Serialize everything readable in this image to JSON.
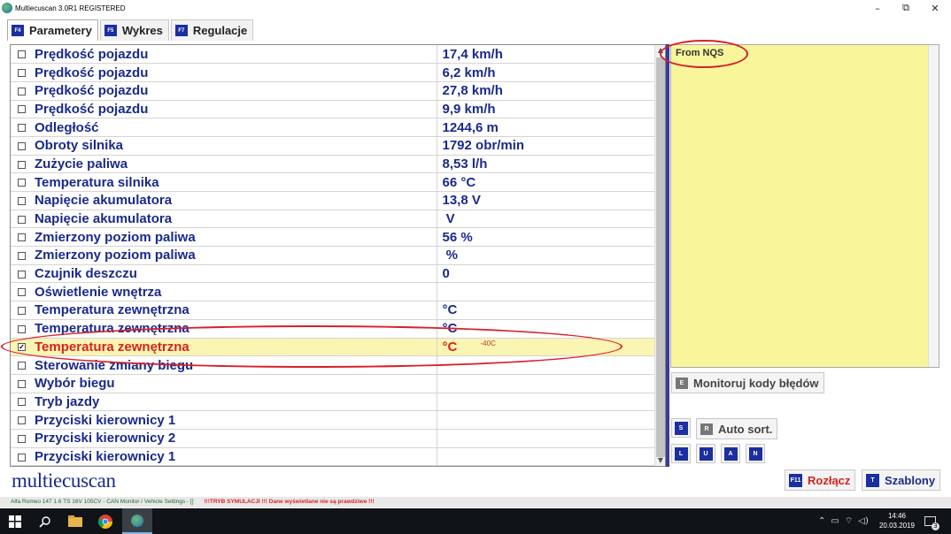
{
  "window": {
    "title": "Multiecuscan 3.0R1 REGISTERED"
  },
  "window_controls": {
    "minimize": "–",
    "maximize": "⧉",
    "close": "✕"
  },
  "tabs": [
    {
      "key": "F4",
      "label": "Parametery"
    },
    {
      "key": "F5",
      "label": "Wykres"
    },
    {
      "key": "F7",
      "label": "Regulacje"
    }
  ],
  "parameters": [
    {
      "checked": false,
      "name": "Prędkość pojazdu",
      "value": "17,4 km/h"
    },
    {
      "checked": false,
      "name": "Prędkość pojazdu",
      "value": "6,2 km/h"
    },
    {
      "checked": false,
      "name": "Prędkość pojazdu",
      "value": "27,8 km/h"
    },
    {
      "checked": false,
      "name": "Prędkość pojazdu",
      "value": "9,9 km/h"
    },
    {
      "checked": false,
      "name": "Odległość",
      "value": "1244,6 m"
    },
    {
      "checked": false,
      "name": "Obroty silnika",
      "value": "1792 obr/min"
    },
    {
      "checked": false,
      "name": "Zużycie paliwa",
      "value": "8,53 l/h"
    },
    {
      "checked": false,
      "name": "Temperatura silnika",
      "value": "66 °C"
    },
    {
      "checked": false,
      "name": "Napięcie akumulatora",
      "value": "13,8 V"
    },
    {
      "checked": false,
      "name": "Napięcie akumulatora",
      "value": " V"
    },
    {
      "checked": false,
      "name": "Zmierzony poziom paliwa",
      "value": "56 %"
    },
    {
      "checked": false,
      "name": "Zmierzony poziom paliwa",
      "value": " %"
    },
    {
      "checked": false,
      "name": "Czujnik deszczu",
      "value": "0"
    },
    {
      "checked": false,
      "name": "Oświetlenie wnętrza",
      "value": ""
    },
    {
      "checked": false,
      "name": "Temperatura zewnętrzna",
      "value": "°C"
    },
    {
      "checked": false,
      "name": "Temperatura zewnętrzna",
      "value": "°C"
    },
    {
      "checked": true,
      "name": "Temperatura zewnętrzna",
      "value": "°C",
      "note": "-40C",
      "highlighted": true
    },
    {
      "checked": false,
      "name": "Sterowanie zmiany biegu",
      "value": ""
    },
    {
      "checked": false,
      "name": "Wybór biegu",
      "value": ""
    },
    {
      "checked": false,
      "name": "Tryb jazdy",
      "value": ""
    },
    {
      "checked": false,
      "name": "Przyciski kierownicy 1",
      "value": ""
    },
    {
      "checked": false,
      "name": "Przyciski kierownicy 2",
      "value": ""
    },
    {
      "checked": false,
      "name": "Przyciski kierownicy 1",
      "value": ""
    }
  ],
  "notes_panel": {
    "text": "From NQS"
  },
  "buttons": {
    "monitor": {
      "key": "E",
      "label": "Monitoruj kody błędów"
    },
    "s_key": "S",
    "auto_sort": {
      "key": "R",
      "label": "Auto sort."
    },
    "small_keys": [
      "L",
      "U",
      "A",
      "N"
    ],
    "disconnect": {
      "key": "F11",
      "label": "Rozłącz"
    },
    "templates": {
      "key": "T",
      "label": "Szablony"
    }
  },
  "brand": "multiecuscan",
  "status": {
    "vehicle": "Alfa Romeo 147 1.6 TS 16V 105CV - CAN Monitor / Vehicle Settings - []",
    "warning": "!!!TRYB SYMULACJI !!! Dane wyświetlane nie są prawdziwe !!!"
  },
  "taskbar": {
    "time": "14:46",
    "date": "20.03.2019",
    "notifications": "3"
  },
  "colors": {
    "accent": "#1a2a8a",
    "highlight_row": "#fbf5b3",
    "highlight_text": "#d4231f",
    "notes_bg": "#f8f59b",
    "annotation": "#d8202a"
  }
}
